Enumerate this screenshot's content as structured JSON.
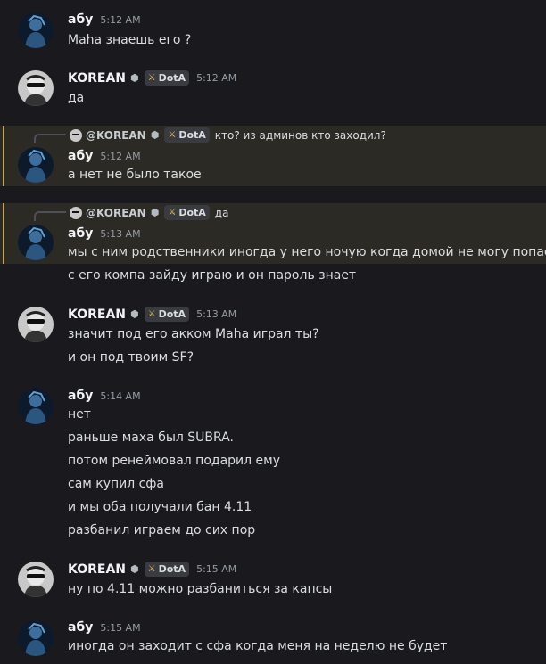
{
  "users": {
    "abu": {
      "name": "абу"
    },
    "korean": {
      "name": "KOREAN",
      "tag": "DotA"
    }
  },
  "messages": [
    {
      "author": "абу",
      "time": "5:12 AM",
      "lines": [
        "Maha знаешь его ?"
      ]
    },
    {
      "author": "KOREAN",
      "time": "5:12 AM",
      "tag": "DotA",
      "lines": [
        "да"
      ]
    },
    {
      "author": "абу",
      "time": "5:12 AM",
      "reply_to": "@KOREAN",
      "reply_tag": "DotA",
      "reply_text": "кто? из админов кто заходил?",
      "lines": [
        "а нет не было такое"
      ]
    },
    {
      "author": "абу",
      "time": "5:13 AM",
      "reply_to": "@KOREAN",
      "reply_tag": "DotA",
      "reply_text": "да",
      "lines": [
        "мы с ним родственники иногда у него ночую когда домой не могу попасть",
        "с его компа зайду играю и он пароль знает"
      ]
    },
    {
      "author": "KOREAN",
      "time": "5:13 AM",
      "tag": "DotA",
      "lines": [
        "значит под его акком Maha играл ты?",
        "и он под твоим SF?"
      ]
    },
    {
      "author": "абу",
      "time": "5:14 AM",
      "lines": [
        "нет",
        "раньше маха был SUBRA.",
        "потом ренеймовал подарил ему",
        "сам купил сфа",
        "и мы оба получали бан 4.11",
        "разбанил играем до сих пор"
      ]
    },
    {
      "author": "KOREAN",
      "time": "5:15 AM",
      "tag": "DotA",
      "lines": [
        "ну по 4.11 можно разбаниться за капсы"
      ]
    },
    {
      "author": "абу",
      "time": "5:15 AM",
      "lines": [
        "иногда он заходит с сфа когда меня на неделю не будет"
      ]
    }
  ]
}
